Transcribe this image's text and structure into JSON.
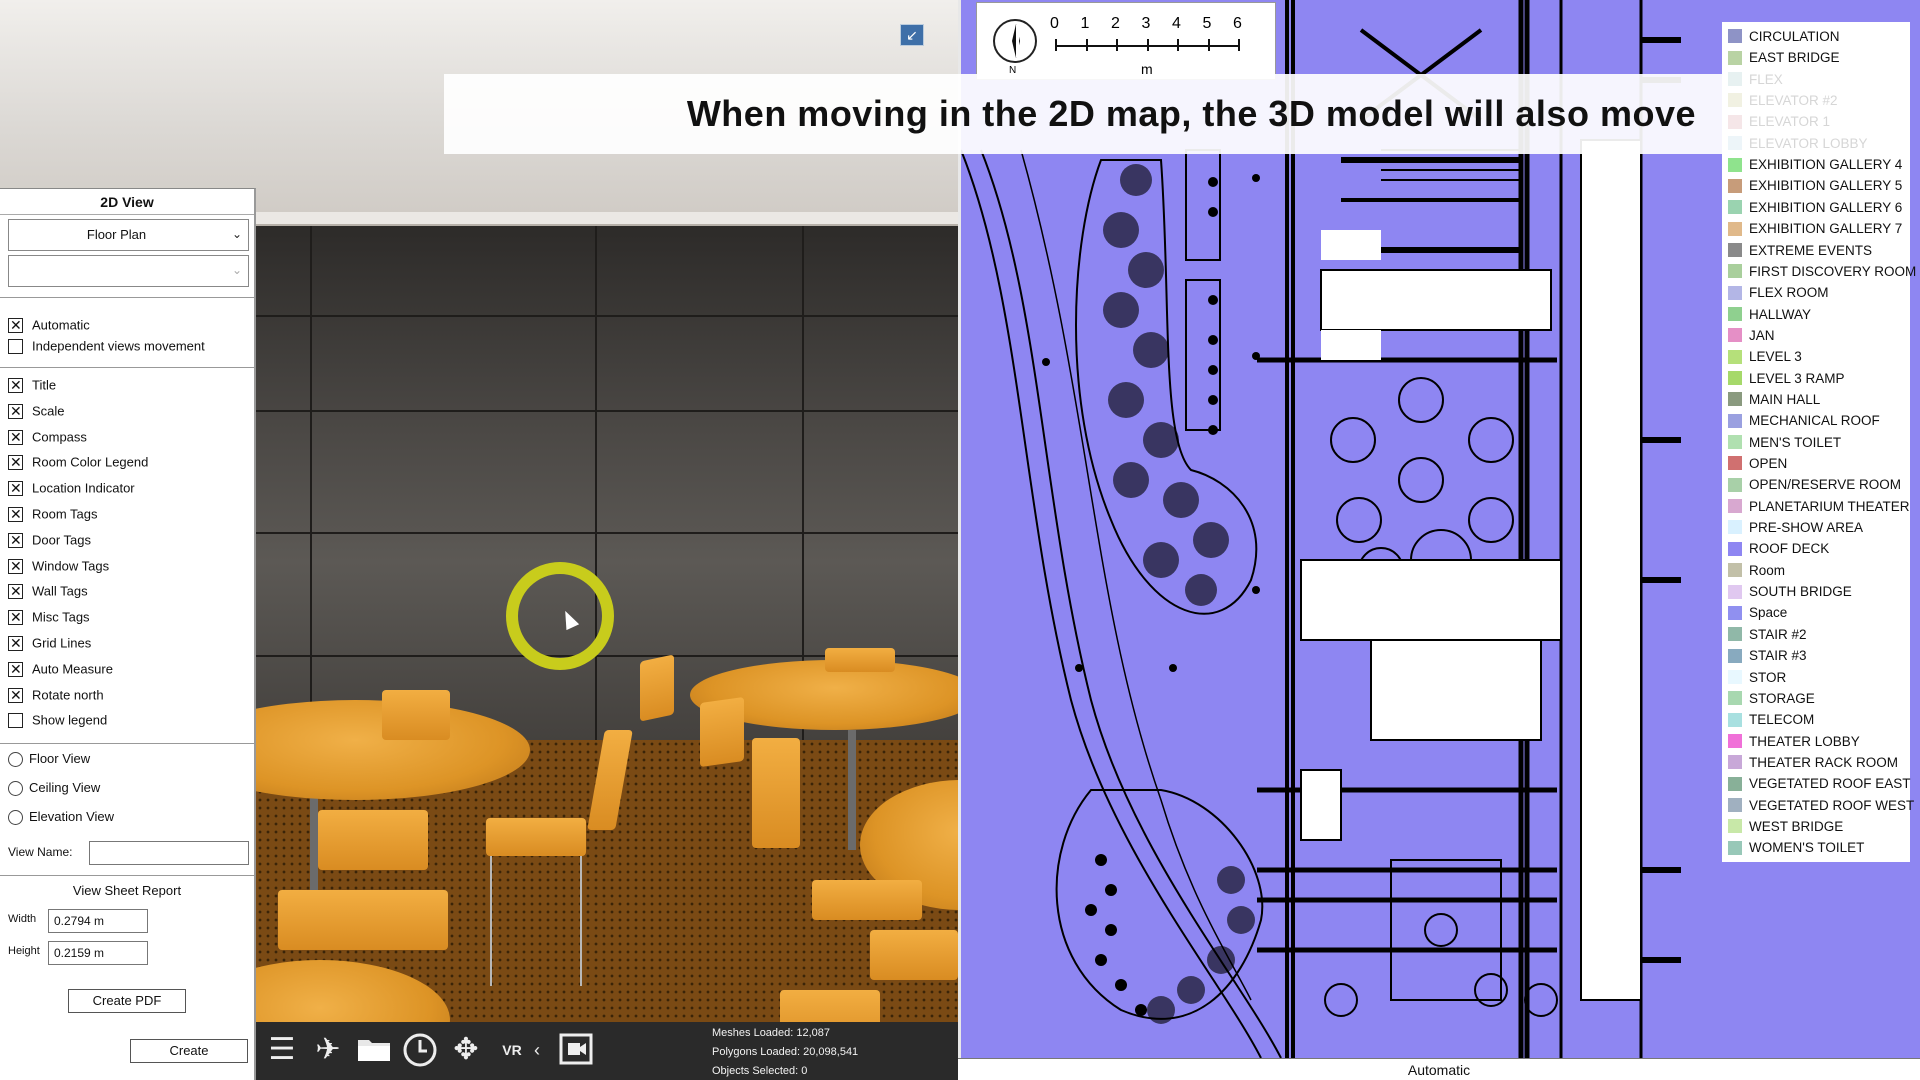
{
  "caption": "When moving in the 2D map, the 3D model will also move",
  "panel": {
    "title": "2D View",
    "view_select": "Floor Plan",
    "level_select": "",
    "mode_checks": [
      {
        "label": "Automatic",
        "checked": true
      },
      {
        "label": "Independent views movement",
        "checked": false
      }
    ],
    "display_checks": [
      {
        "label": "Title",
        "checked": true
      },
      {
        "label": "Scale",
        "checked": true
      },
      {
        "label": "Compass",
        "checked": true
      },
      {
        "label": "Room Color Legend",
        "checked": true
      },
      {
        "label": "Location Indicator",
        "checked": true
      },
      {
        "label": "Room Tags",
        "checked": true
      },
      {
        "label": "Door Tags",
        "checked": true
      },
      {
        "label": "Window Tags",
        "checked": true
      },
      {
        "label": "Wall Tags",
        "checked": true
      },
      {
        "label": "Misc Tags",
        "checked": true
      },
      {
        "label": "Grid Lines",
        "checked": true
      },
      {
        "label": "Auto Measure",
        "checked": true
      },
      {
        "label": "Rotate north",
        "checked": true
      },
      {
        "label": "Show legend",
        "checked": false
      }
    ],
    "view_radios": [
      "Floor View",
      "Ceiling View",
      "Elevation View"
    ],
    "view_name_label": "View Name:",
    "view_name_value": "",
    "sheet_report_title": "View Sheet Report",
    "width_label": "Width",
    "width_value": "0.2794 m",
    "height_label": "Height",
    "height_value": "0.2159 m",
    "create_pdf_label": "Create PDF",
    "create_label": "Create"
  },
  "toolbar": {
    "icons": [
      "list-icon",
      "fly-icon",
      "folder-icon",
      "clock-icon",
      "move-icon",
      "vr-icon",
      "collapse-arrow-icon",
      "video-icon"
    ],
    "vr_text": "VR"
  },
  "stats": {
    "meshes": "Meshes Loaded: 12,087",
    "polygons": "Polygons Loaded: 20,098,541",
    "selected": "Objects Selected: 0"
  },
  "scale": {
    "numbers": [
      "0",
      "1",
      "2",
      "3",
      "4",
      "5",
      "6"
    ],
    "unit": "m",
    "north": "N"
  },
  "map_status": "Automatic",
  "legend": [
    {
      "label": "CIRCULATION",
      "color": "#8e93c6",
      "faded": false
    },
    {
      "label": "EAST BRIDGE",
      "color": "#b9d3a4",
      "faded": false
    },
    {
      "label": "FLEX",
      "color": "#a0c7c6",
      "faded": true
    },
    {
      "label": "ELEVATOR #2",
      "color": "#c9c98d",
      "faded": true
    },
    {
      "label": "ELEVATOR 1",
      "color": "#d89aa2",
      "faded": true
    },
    {
      "label": "ELEVATOR LOBBY",
      "color": "#b8d7e6",
      "faded": true
    },
    {
      "label": "EXHIBITION GALLERY 4",
      "color": "#8fe38d",
      "faded": false
    },
    {
      "label": "EXHIBITION GALLERY 5",
      "color": "#c79c7a",
      "faded": false
    },
    {
      "label": "EXHIBITION GALLERY 6",
      "color": "#9ad3b0",
      "faded": false
    },
    {
      "label": "EXHIBITION GALLERY 7",
      "color": "#e0b98a",
      "faded": false
    },
    {
      "label": "EXTREME EVENTS",
      "color": "#8a8a8a",
      "faded": false
    },
    {
      "label": "FIRST DISCOVERY ROOM",
      "color": "#a9cf9c",
      "faded": false
    },
    {
      "label": "FLEX ROOM",
      "color": "#b3b6e6",
      "faded": false
    },
    {
      "label": "HALLWAY",
      "color": "#8fd08f",
      "faded": false
    },
    {
      "label": "JAN",
      "color": "#e58fc6",
      "faded": false
    },
    {
      "label": "LEVEL 3",
      "color": "#b5e07a",
      "faded": false
    },
    {
      "label": "LEVEL 3 RAMP",
      "color": "#a6d96a",
      "faded": false
    },
    {
      "label": "MAIN HALL",
      "color": "#8a9a7f",
      "faded": false
    },
    {
      "label": "MECHANICAL ROOF",
      "color": "#9aa0e0",
      "faded": false
    },
    {
      "label": "MEN'S TOILET",
      "color": "#b0e0b0",
      "faded": false
    },
    {
      "label": "OPEN",
      "color": "#d07070",
      "faded": false
    },
    {
      "label": "OPEN/RESERVE ROOM",
      "color": "#a8d0a8",
      "faded": false
    },
    {
      "label": "PLANETARIUM THEATER",
      "color": "#d8a8d0",
      "faded": false
    },
    {
      "label": "PRE-SHOW AREA",
      "color": "#d9f1ff",
      "faded": false
    },
    {
      "label": "ROOF DECK",
      "color": "#8e86f2",
      "faded": false
    },
    {
      "label": "Room",
      "color": "#c2c0a8",
      "faded": false
    },
    {
      "label": "SOUTH BRIDGE",
      "color": "#e0c8f0",
      "faded": false
    },
    {
      "label": "Space",
      "color": "#9090f0",
      "faded": false
    },
    {
      "label": "STAIR #2",
      "color": "#90b8a8",
      "faded": false
    },
    {
      "label": "STAIR #3",
      "color": "#88aabf",
      "faded": false
    },
    {
      "label": "STOR",
      "color": "#e8f8ff",
      "faded": false
    },
    {
      "label": "STORAGE",
      "color": "#a8d8b0",
      "faded": false
    },
    {
      "label": "TELECOM",
      "color": "#a8e0e0",
      "faded": false
    },
    {
      "label": "THEATER LOBBY",
      "color": "#f070d8",
      "faded": false
    },
    {
      "label": "THEATER RACK ROOM",
      "color": "#c8a8d8",
      "faded": false
    },
    {
      "label": "VEGETATED ROOF EAST",
      "color": "#88b098",
      "faded": false
    },
    {
      "label": "VEGETATED ROOF WEST",
      "color": "#a0b0c0",
      "faded": false
    },
    {
      "label": "WEST BRIDGE",
      "color": "#c8e8a8",
      "faded": false
    },
    {
      "label": "WOMEN'S TOILET",
      "color": "#98c8b8",
      "faded": false
    }
  ]
}
